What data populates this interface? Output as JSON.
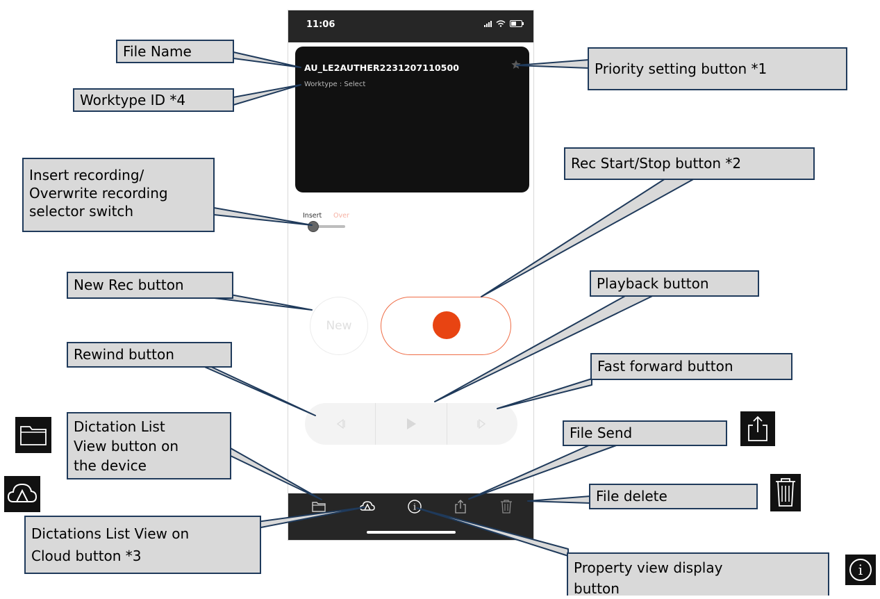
{
  "phone": {
    "status_time": "11:06",
    "file_name": "AU_LE2AUTHER2231207110500",
    "worktype_text": "Worktype : Select",
    "mode_insert_label": "Insert",
    "mode_over_label": "Over",
    "mode_selected": "Insert",
    "new_button_label": "New",
    "colors": {
      "rec_accent": "#e84412",
      "dark_bar": "#262626",
      "card_bg": "#111111"
    },
    "icons": {
      "star": "star-icon",
      "rewind": "rewind-icon",
      "play": "play-icon",
      "fast_forward": "fast-forward-icon",
      "folder": "folder-icon",
      "cloud": "cloud-icon",
      "info": "info-icon",
      "share": "share-icon",
      "trash": "trash-icon"
    }
  },
  "callouts": {
    "file_name": "File Name",
    "worktype_id": "Worktype ID *4",
    "priority": "Priority setting button *1",
    "insert_overwrite_line1": "Insert recording/",
    "insert_overwrite_line2": "Overwrite recording",
    "insert_overwrite_line3": "selector switch",
    "rec_start_stop": "Rec Start/Stop button *2",
    "new_rec": "New Rec button",
    "playback": "Playback button",
    "rewind": "Rewind button",
    "fast_forward": "Fast forward button",
    "dictation_list_line1": "Dictation List",
    "dictation_list_line2": "View button on",
    "dictation_list_line3": "the device",
    "file_send": "File Send",
    "file_delete": "File delete",
    "cloud_line1": "Dictations List View on",
    "cloud_line2": "Cloud button *3",
    "property_line1": "Property view display",
    "property_line2": "button"
  }
}
